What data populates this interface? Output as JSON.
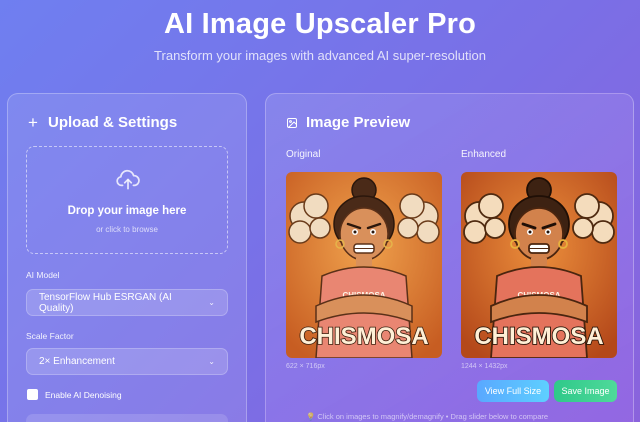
{
  "header": {
    "title": "AI Image Upscaler Pro",
    "subtitle": "Transform your images with advanced AI super-resolution"
  },
  "left_panel": {
    "title": "Upload & Settings",
    "dropzone": {
      "title": "Drop your image here",
      "subtitle": "or click to browse"
    },
    "model_label": "AI Model",
    "model_value": "TensorFlow Hub ESRGAN (AI Quality)",
    "scale_label": "Scale Factor",
    "scale_value": "2× Enhancement",
    "denoise_label": "Enable AI Denoising",
    "denoise_checked": false
  },
  "right_panel": {
    "title": "Image Preview",
    "original_label": "Original",
    "enhanced_label": "Enhanced",
    "original_dims": "622 × 716px",
    "enhanced_dims": "1244 × 1432px",
    "caption_text": "CHISMOSA",
    "shirt_text": "CHISMOSA",
    "view_button": "View Full Size",
    "save_button": "Save Image",
    "hint": "💡 Click on images to magnify/demagnify • Drag slider below to compare"
  },
  "colors": {
    "view_button": "#59a8ff",
    "save_button": "#2fc98a",
    "image_bg": "#d86b2a"
  }
}
